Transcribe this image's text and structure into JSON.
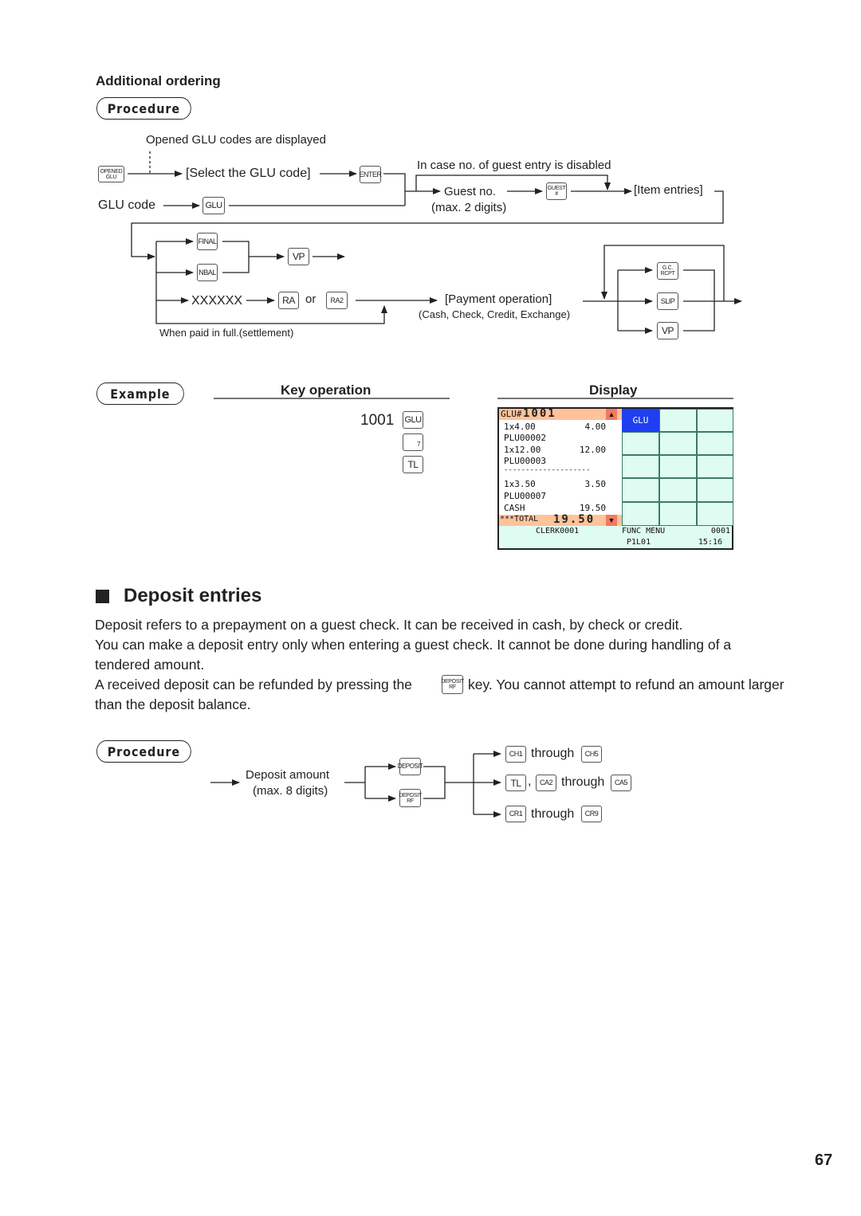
{
  "page_number": "67",
  "additional_ordering": {
    "heading": "Additional ordering",
    "procedure_label": "Procedure",
    "opened_glu_note": "Opened GLU codes are displayed",
    "select_glu_code": "[Select the GLU code]",
    "glu_code_label": "GLU code",
    "guest_disabled_note": "In case no. of guest entry is disabled",
    "guest_no": "Guest no.",
    "guest_no_max": "(max. 2 digits)",
    "item_entries": "[Item entries]",
    "xxxxxx": "XXXXXX",
    "or": "or",
    "payment_operation": "[Payment operation]",
    "payment_types": "(Cash, Check, Credit, Exchange)",
    "paid_in_full": "When paid in full.(settlement)",
    "keys": {
      "opened_glu": [
        "OPENED",
        "GLU"
      ],
      "enter": "ENTER",
      "glu": "GLU",
      "guest": [
        "GUEST",
        "#"
      ],
      "final": "FINAL",
      "nbal": "NBAL",
      "vp": "VP",
      "ra": "RA",
      "ra2": "RA2",
      "gc_rcpt": [
        "G.C.",
        "RCPT"
      ],
      "slip": "SLIP"
    }
  },
  "example": {
    "label": "Example",
    "key_operation_header": "Key operation",
    "display_header": "Display",
    "key_ops": [
      {
        "value": "1001",
        "key": "GLU"
      },
      {
        "value": "",
        "key": "7"
      },
      {
        "value": "",
        "key": "TL"
      }
    ],
    "display": {
      "title_prefix": "GLU#",
      "title_number": "1001",
      "lines": [
        {
          "left": "1x4.00",
          "right": "4.00"
        },
        {
          "left": "PLU00002",
          "right": ""
        },
        {
          "left": "1x12.00",
          "right": "12.00"
        },
        {
          "left": "PLU00003",
          "right": ""
        },
        {
          "left": "--------------------",
          "right": ""
        },
        {
          "left": "1x3.50",
          "right": "3.50"
        },
        {
          "left": "PLU00007",
          "right": ""
        },
        {
          "left": "CASH",
          "right": "19.50"
        }
      ],
      "total_label": "***TOTAL",
      "total_value": "19.50",
      "footer_clerk": "CLERK0001",
      "footer_menu": "FUNC MENU",
      "footer_code": "0001",
      "footer_page": "P1L01",
      "footer_time": "15:16",
      "glu_button": "GLU",
      "colors": {
        "header_bg": "#ffc39a",
        "scroll_btn": "#f4795f",
        "glu_button": "#1f3ff0",
        "grid_bg": "#dffcf3",
        "footer_bg": "#dffcf3"
      }
    }
  },
  "deposit": {
    "heading": "Deposit entries",
    "paragraph1": "Deposit refers to a prepayment on a guest check.  It can be received in cash, by check or credit.",
    "paragraph2a": "You can make a deposit entry only when entering a guest check.  It cannot be done during handling of a",
    "paragraph2b": "tendered amount.",
    "paragraph3a_pre": "A received deposit can be refunded by pressing the",
    "paragraph3a_post": "key. You cannot attempt to refund an amount larger",
    "paragraph3b": "than the deposit balance.",
    "procedure_label": "Procedure",
    "deposit_amount": "Deposit amount",
    "deposit_max": "(max. 8 digits)",
    "through": "through",
    "comma": ",",
    "keys": {
      "deposit": "DEPOSIT",
      "deposit_rf": [
        "DEPOSIT",
        "RF"
      ],
      "ch1": "CH1",
      "ch5": "CH5",
      "tl": "TL",
      "ca2": "CA2",
      "ca5": "CA5",
      "cr1": "CR1",
      "cr9": "CR9"
    }
  }
}
